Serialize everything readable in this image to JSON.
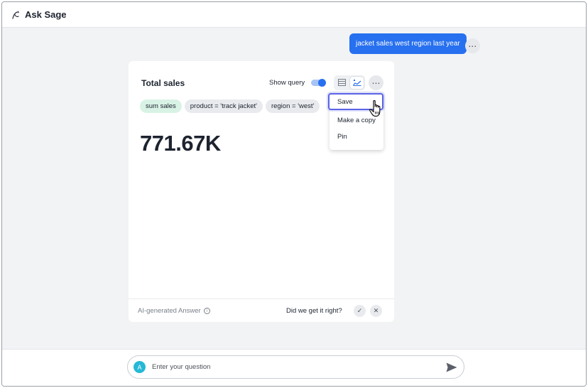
{
  "app": {
    "title": "Ask Sage"
  },
  "conversation": {
    "user_message": "jacket sales west region last year",
    "more_glyph": "⋯"
  },
  "answer_card": {
    "title": "Total sales",
    "show_query_label": "Show query",
    "show_query_on": true,
    "more_glyph": "⋯",
    "chips": [
      {
        "label": "sum sales",
        "kind": "measure"
      },
      {
        "label": "product = 'track jacket'",
        "kind": "filter"
      },
      {
        "label": "region = 'west'",
        "kind": "filter"
      }
    ],
    "value": "771.67K",
    "footer": {
      "ai_label": "AI-generated Answer",
      "info_glyph": "i",
      "feedback_question": "Did we get it right?",
      "yes_glyph": "✓",
      "no_glyph": "✕"
    }
  },
  "menu": {
    "items": [
      "Save",
      "Make a copy",
      "Pin"
    ],
    "hovered": "Save"
  },
  "input": {
    "avatar_letter": "A",
    "placeholder": "Enter your question"
  },
  "colors": {
    "accent": "#2770ef",
    "focus_ring": "#5a63e6",
    "measure_chip": "#d9f2e6",
    "avatar": "#26b8d6"
  },
  "icons": {
    "app": "sage-sparkle-icon",
    "table_viz": "table-icon",
    "chart_viz": "chart-icon",
    "send": "send-icon",
    "cursor": "hand-pointer-icon"
  }
}
